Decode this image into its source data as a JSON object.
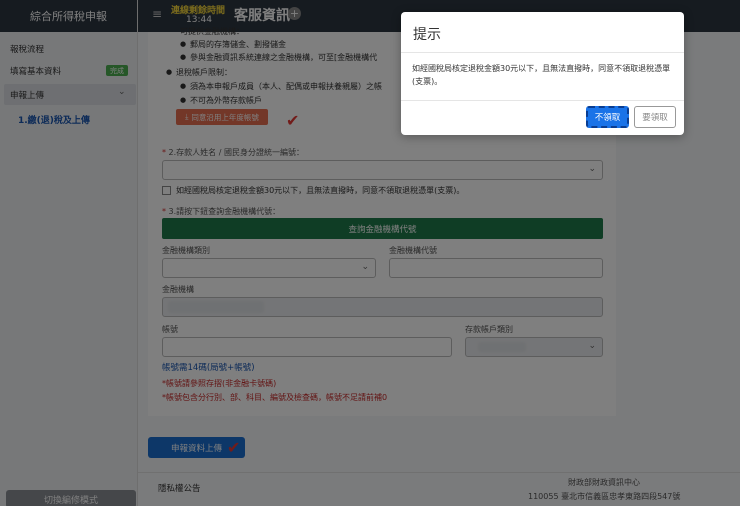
{
  "sidebar": {
    "title": "綜合所得稅申報",
    "items": [
      {
        "label": "報稅流程"
      },
      {
        "label": "填寫基本資料",
        "badge": "完成"
      },
      {
        "label": "申報上傳"
      },
      {
        "label": "1.繳(退)稅及上傳"
      }
    ],
    "switch_label": "切換編修模式"
  },
  "header": {
    "timer_label": "連線剩餘時間",
    "timer_value": "13:44",
    "title": "客服資訊",
    "plus": "+"
  },
  "refund_info": {
    "line_top": "可提供金融機構：",
    "line1": "郵局的存簿儲金、劃撥儲金",
    "line2": "參與金融資訊系統連線之金融機構，可至[金融機構代",
    "line3": "退稅帳戶限制：",
    "line4": "須為本申報戶成員（本人、配偶或申報扶養親屬）之帳",
    "line5": "不可為外幣存款帳戶",
    "prev_year_button": "同意沿用上年度帳號"
  },
  "form": {
    "section2_label": "2.存款人姓名 / 國民身分證統一編號：",
    "checkbox_label": "如經國稅局核定退稅金額30元以下，且無法直撥時，同意不領取退稅憑單(支票)。",
    "section3_label": "3.請按下鈕查詢金融機構代號：",
    "query_button": "查詢金融機構代號",
    "bank_type_label": "金融機構類別",
    "bank_code_label": "金融機構代號",
    "bank_name_label": "金融機構",
    "account_label": "帳號",
    "account_type_label": "存款帳戶類別",
    "account_hint": "帳號需14碼(局號+帳號)",
    "note1": "*帳號請參照存摺(非金融卡號碼)",
    "note2": "*帳號包含分行別、部、科目、編號及檢查碼，帳號不足請前補0",
    "required_mark": "*"
  },
  "submit_button": "申報資料上傳",
  "footer": {
    "privacy": "隱私權公告",
    "org": "財政部財政資訊中心",
    "address": "110055 臺北市信義區忠孝東路四段547號"
  },
  "modal": {
    "title": "提示",
    "body": "如經國稅局核定退稅金額30元以下，且無法直撥時，同意不領取退稅憑單(支票)。",
    "decline_button": "不領取",
    "accept_button": "要領取"
  },
  "colors": {
    "header_bg": "#2d3640",
    "primary": "#1a73e8",
    "query_green": "#1e7a4a",
    "warn_orange": "#e66f51",
    "error_red": "#c62828"
  }
}
